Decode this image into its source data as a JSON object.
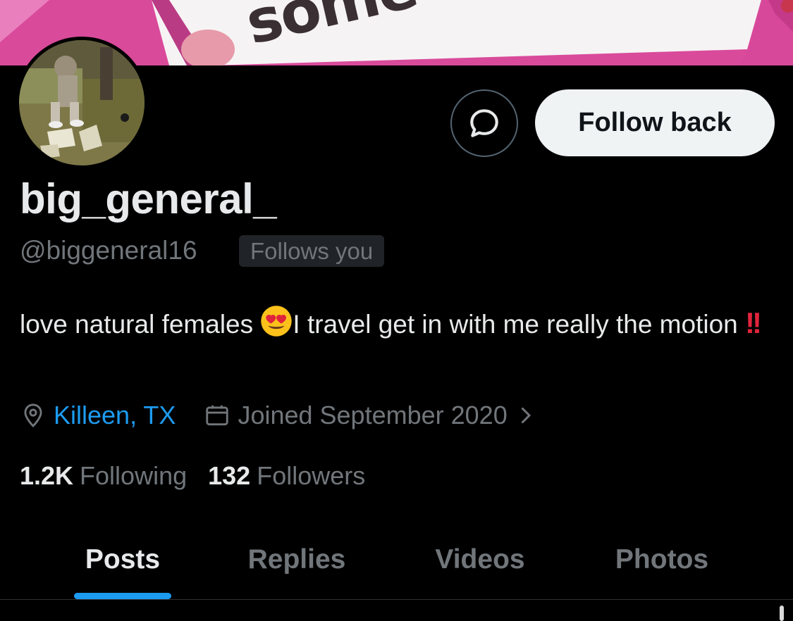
{
  "banner": {
    "text": "some"
  },
  "profile": {
    "display_name": "big_general_",
    "handle": "@biggeneral16",
    "follows_you_label": "Follows you",
    "bio_part1": "love natural females ",
    "bio_emoji1": "smiling-face-with-heart-eyes",
    "bio_part2": "I travel get in with me really the motion ",
    "bio_emoji2": "double-exclamation",
    "bio_emoji2_text": "!!",
    "location": "Killeen, TX",
    "joined": "Joined September 2020"
  },
  "actions": {
    "message_icon": "message-bubble-icon",
    "follow_back_label": "Follow back"
  },
  "stats": {
    "following_count": "1.2K",
    "following_label": "Following",
    "followers_count": "132",
    "followers_label": "Followers"
  },
  "tabs": [
    {
      "label": "Posts",
      "active": true
    },
    {
      "label": "Replies",
      "active": false
    },
    {
      "label": "Videos",
      "active": false
    },
    {
      "label": "Photos",
      "active": false
    }
  ],
  "colors": {
    "background": "#000000",
    "text_primary": "#e7e9ea",
    "text_secondary": "#71767b",
    "accent": "#1d9bf0",
    "follow_button_bg": "#eff3f4",
    "banner_pink": "#d9499a"
  }
}
